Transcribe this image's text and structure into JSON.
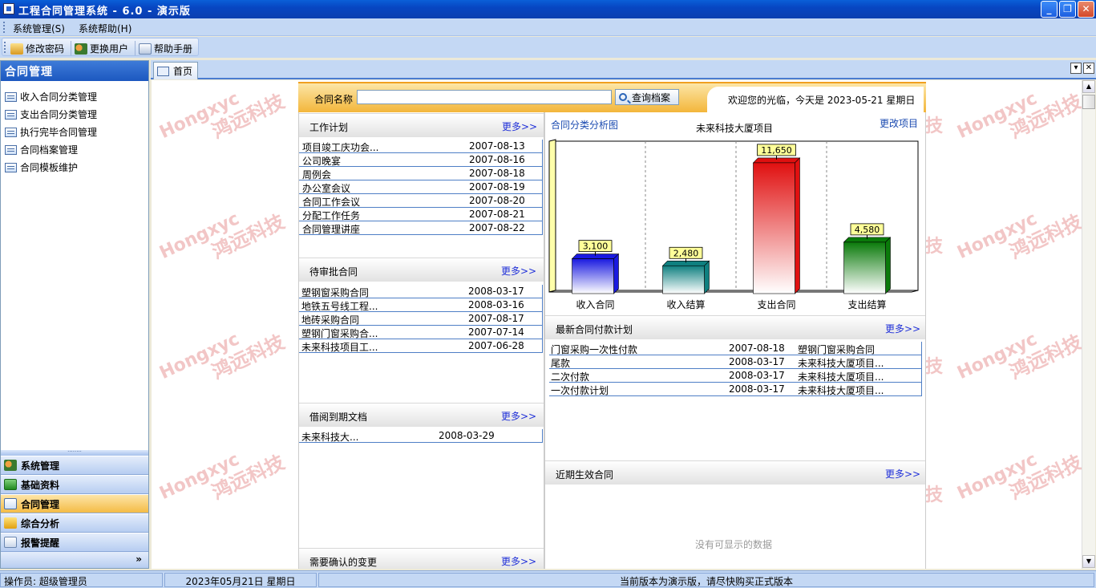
{
  "window": {
    "title": "工程合同管理系统 - 6.0 - 演示版"
  },
  "menu": {
    "items": [
      "系统管理(S)",
      "系统帮助(H)"
    ]
  },
  "toolbar": {
    "change_password": "修改密码",
    "switch_user": "更换用户",
    "help_manual": "帮助手册"
  },
  "sidebar": {
    "title": "合同管理",
    "items": [
      "收入合同分类管理",
      "支出合同分类管理",
      "执行完毕合同管理",
      "合同档案管理",
      "合同模板维护"
    ],
    "groups": [
      "系统管理",
      "基础资料",
      "合同管理",
      "综合分析",
      "报警提醒"
    ],
    "active_group": "合同管理",
    "footer_chevron": "»"
  },
  "tabs": {
    "home": "首页"
  },
  "watermark": {
    "latin": "Hongxyc",
    "cn": "鸿远科技",
    "partial": "技"
  },
  "search": {
    "label": "合同名称",
    "value": "",
    "button": "查询档案"
  },
  "welcome": "欢迎您的光临，今天是 2023-05-21 星期日",
  "work_plan": {
    "title": "工作计划",
    "more": "更多>>",
    "rows": [
      [
        "项目竣工庆功会...",
        "2007-08-13"
      ],
      [
        "公司晚宴",
        "2007-08-16"
      ],
      [
        "周例会",
        "2007-08-18"
      ],
      [
        "办公室会议",
        "2007-08-19"
      ],
      [
        "合同工作会议",
        "2007-08-20"
      ],
      [
        "分配工作任务",
        "2007-08-21"
      ],
      [
        "合同管理讲座",
        "2007-08-22"
      ]
    ]
  },
  "pending": {
    "title": "待审批合同",
    "more": "更多>>",
    "rows": [
      [
        "塑钢窗采购合同",
        "2008-03-17"
      ],
      [
        "地铁五号线工程...",
        "2008-03-16"
      ],
      [
        "地砖采购合同",
        "2007-08-17"
      ],
      [
        "塑钢门窗采购合...",
        "2007-07-14"
      ],
      [
        "未来科技项目工...",
        "2007-06-28"
      ]
    ]
  },
  "borrowed": {
    "title": "借阅到期文档",
    "more": "更多>>",
    "rows": [
      [
        "未来科技大...",
        "2008-03-29"
      ]
    ]
  },
  "changes": {
    "title": "需要确认的变更",
    "more": "更多>>"
  },
  "chart_panel": {
    "title": "合同分类分析图",
    "project": "未来科技大厦项目",
    "edit": "更改项目"
  },
  "chart_data": {
    "type": "bar",
    "categories": [
      "收入合同",
      "收入结算",
      "支出合同",
      "支出结算"
    ],
    "values": [
      3100,
      2480,
      11650,
      4580
    ],
    "value_labels": [
      "3,100",
      "2,480",
      "11,650",
      "4,580"
    ],
    "ylim": [
      0,
      13000
    ],
    "grid": "vertical dashed",
    "colors": [
      "#1a1ae0",
      "#0f8080",
      "#e01010",
      "#0a7a0a"
    ]
  },
  "payment_plan": {
    "title": "最新合同付款计划",
    "more": "更多>>",
    "rows": [
      [
        "门窗采购一次性付款",
        "2007-08-18",
        "塑钢门窗采购合同"
      ],
      [
        "尾款",
        "2008-03-17",
        "未来科技大厦项目..."
      ],
      [
        "二次付款",
        "2008-03-17",
        "未来科技大厦项目..."
      ],
      [
        "一次付款计划",
        "2008-03-17",
        "未来科技大厦项目..."
      ]
    ]
  },
  "recent": {
    "title": "近期生效合同",
    "more": "更多>>",
    "empty": "没有可显示的数据"
  },
  "status": {
    "operator": "操作员: 超级管理员",
    "date": "2023年05月21日 星期日",
    "notice": "当前版本为演示版，请尽快购买正式版本"
  }
}
